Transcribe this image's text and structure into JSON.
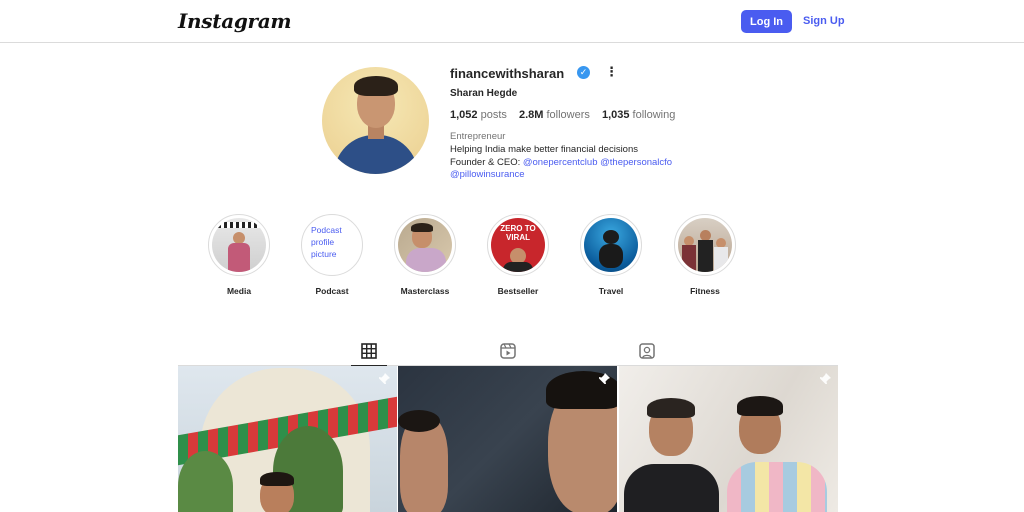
{
  "header": {
    "logo_text": "Instagram",
    "login_label": "Log In",
    "signup_label": "Sign Up"
  },
  "profile": {
    "username": "financewithsharan",
    "verified_mark": "✓",
    "full_name": "Sharan Hegde",
    "posts_count": "1,052",
    "posts_label": "posts",
    "followers_count": "2.8M",
    "followers_label": "followers",
    "following_count": "1,035",
    "following_label": "following",
    "category": "Entrepreneur",
    "bio_line1": "Helping India make better financial decisions",
    "bio_line2_prefix": "Founder & CEO:",
    "mention1": "@onepercentclub",
    "mention2": "@thepersonalcfo",
    "mention3": "@pillowinsurance"
  },
  "highlights": [
    {
      "label": "Media"
    },
    {
      "label": "Podcast",
      "alt_text": "Podcast profile picture"
    },
    {
      "label": "Masterclass"
    },
    {
      "label": "Bestseller",
      "cover_text": "ZERO TO VIRAL"
    },
    {
      "label": "Travel"
    },
    {
      "label": "Fitness"
    }
  ],
  "tabs": [
    {
      "icon": "grid-icon",
      "active": true
    },
    {
      "icon": "reels-icon",
      "active": false
    },
    {
      "icon": "tagged-icon",
      "active": false
    }
  ],
  "colors": {
    "accent": "#4a5cf0",
    "verified": "#3897f0",
    "border": "#dbdbdb"
  }
}
